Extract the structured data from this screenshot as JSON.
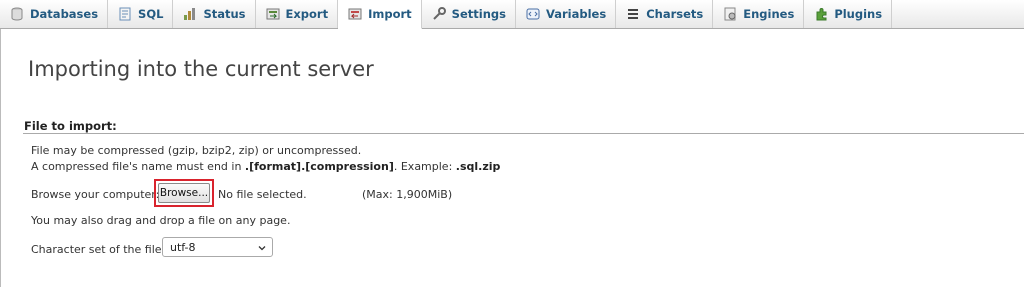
{
  "tabs": [
    {
      "label": "Databases",
      "icon": "databases-icon",
      "active": false
    },
    {
      "label": "SQL",
      "icon": "sql-icon",
      "active": false
    },
    {
      "label": "Status",
      "icon": "status-icon",
      "active": false
    },
    {
      "label": "Export",
      "icon": "export-icon",
      "active": false
    },
    {
      "label": "Import",
      "icon": "import-icon",
      "active": true
    },
    {
      "label": "Settings",
      "icon": "settings-icon",
      "active": false
    },
    {
      "label": "Variables",
      "icon": "variables-icon",
      "active": false
    },
    {
      "label": "Charsets",
      "icon": "charsets-icon",
      "active": false
    },
    {
      "label": "Engines",
      "icon": "engines-icon",
      "active": false
    },
    {
      "label": "Plugins",
      "icon": "plugins-icon",
      "active": false
    }
  ],
  "page": {
    "title": "Importing into the current server"
  },
  "file_section": {
    "legend": "File to import:",
    "compress_note": "File may be compressed (gzip, bzip2, zip) or uncompressed.",
    "ext_note_prefix": "A compressed file's name must end in ",
    "ext_note_format": ".[format].[compression]",
    "ext_note_middle": ". Example: ",
    "ext_note_example": ".sql.zip",
    "browse_label": "Browse your computer:",
    "browse_button": "Browse...",
    "no_file": "No file selected.",
    "max_size": "(Max: 1,900MiB)",
    "drag_note": "You may also drag and drop a file on any page.",
    "charset_label": "Character set of the file:",
    "charset_value": "utf-8"
  },
  "colors": {
    "tab_text": "#235a81",
    "highlight_border": "#d9232d"
  }
}
